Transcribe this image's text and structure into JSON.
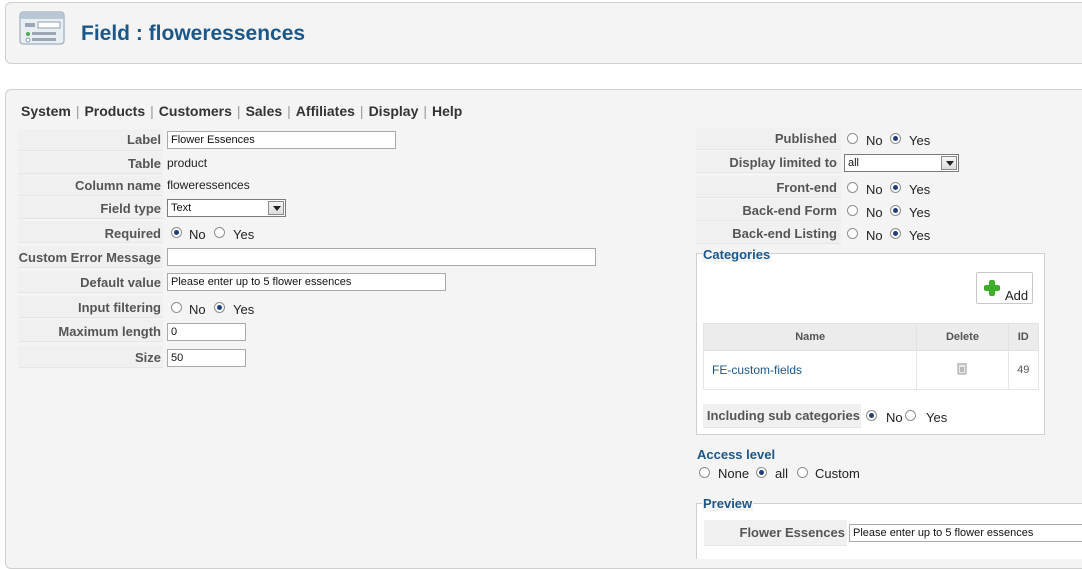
{
  "header": {
    "title": "Field : floweressences",
    "icon": "field-list-icon"
  },
  "menu": {
    "items": [
      "System",
      "Products",
      "Customers",
      "Sales",
      "Affiliates",
      "Display",
      "Help"
    ],
    "separator": "|"
  },
  "form_left": {
    "label": {
      "label": "Label",
      "value": "Flower Essences"
    },
    "table": {
      "label": "Table",
      "value": "product"
    },
    "column_name": {
      "label": "Column name",
      "value": "floweressences"
    },
    "field_type": {
      "label": "Field type",
      "value": "Text"
    },
    "required": {
      "label": "Required",
      "options": [
        "No",
        "Yes"
      ],
      "selected": "No"
    },
    "custom_error": {
      "label": "Custom Error Message",
      "value": ""
    },
    "default_value": {
      "label": "Default value",
      "value": "Please enter up to 5 flower essences"
    },
    "input_filtering": {
      "label": "Input filtering",
      "options": [
        "No",
        "Yes"
      ],
      "selected": "Yes"
    },
    "max_length": {
      "label": "Maximum length",
      "value": "0"
    },
    "size": {
      "label": "Size",
      "value": "50"
    }
  },
  "form_right": {
    "published": {
      "label": "Published",
      "options": [
        "No",
        "Yes"
      ],
      "selected": "Yes"
    },
    "display_limited": {
      "label": "Display limited to",
      "value": "all"
    },
    "front_end": {
      "label": "Front-end",
      "options": [
        "No",
        "Yes"
      ],
      "selected": "Yes"
    },
    "back_end_form": {
      "label": "Back-end Form",
      "options": [
        "No",
        "Yes"
      ],
      "selected": "Yes"
    },
    "back_end_listing": {
      "label": "Back-end Listing",
      "options": [
        "No",
        "Yes"
      ],
      "selected": "Yes"
    }
  },
  "categories": {
    "legend": "Categories",
    "add_label": "Add",
    "columns": [
      "Name",
      "Delete",
      "ID"
    ],
    "rows": [
      {
        "name": "FE-custom-fields",
        "id": "49"
      }
    ],
    "including_sub": {
      "label": "Including sub categories",
      "options": [
        "No",
        "Yes"
      ],
      "selected": "No"
    }
  },
  "access_level": {
    "title": "Access level",
    "options": [
      "None",
      "all",
      "Custom"
    ],
    "selected": "all"
  },
  "preview": {
    "legend": "Preview",
    "label": "Flower Essences",
    "value": "Please enter up to 5 flower essences"
  },
  "colors": {
    "accent": "#1b5789",
    "panel": "#f4f4f4",
    "row": "#f0f0f0"
  }
}
